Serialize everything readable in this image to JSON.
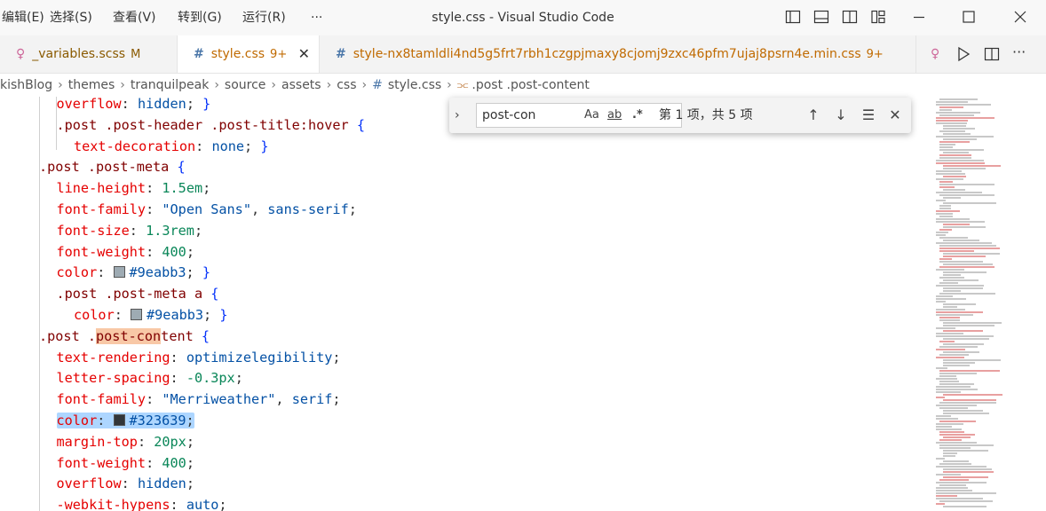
{
  "menu": [
    "编辑(E)",
    "选择(S)",
    "查看(V)",
    "转到(G)",
    "运行(R)",
    "···"
  ],
  "window_title": "style.css - Visual Studio Code",
  "tabs": [
    {
      "label": "_variables.scss",
      "badge": "M",
      "icon": "scss-icon"
    },
    {
      "label": "style.css",
      "badge": "9+",
      "icon": "hash-icon",
      "active": true
    },
    {
      "label": "style-nx8tamldli4nd5g5frt7rbh1czgpjmaxy8cjomj9zxc46pfm7ujaj8psrn4e.min.css",
      "badge": "9+",
      "icon": "hash-icon"
    }
  ],
  "breadcrumb": [
    "kishBlog",
    "themes",
    "tranquilpeak",
    "source",
    "assets",
    "css",
    "style.css",
    ".post .post-content"
  ],
  "find": {
    "query": "post-con",
    "options": [
      "Aa",
      "ab",
      ".*"
    ],
    "count": "第 1 项，共 5 项"
  },
  "code": [
    {
      "indent": 1,
      "parts": [
        [
          "prop",
          "overflow"
        ],
        [
          "punc",
          ": "
        ],
        [
          "val",
          "hidden"
        ],
        [
          "punc",
          "; "
        ],
        [
          "brace",
          "}"
        ]
      ]
    },
    {
      "indent": 1,
      "parts": [
        [
          "sel",
          ".post .post-header .post-title:hover "
        ],
        [
          "brace",
          "{"
        ]
      ]
    },
    {
      "indent": 2,
      "parts": [
        [
          "prop",
          "text-decoration"
        ],
        [
          "punc",
          ": "
        ],
        [
          "val",
          "none"
        ],
        [
          "punc",
          "; "
        ],
        [
          "brace",
          "}"
        ]
      ]
    },
    {
      "indent": 0,
      "parts": [
        [
          "sel",
          ".post .post-meta "
        ],
        [
          "brace",
          "{"
        ]
      ]
    },
    {
      "indent": 1,
      "parts": [
        [
          "prop",
          "line-height"
        ],
        [
          "punc",
          ": "
        ],
        [
          "num",
          "1.5em"
        ],
        [
          "punc",
          ";"
        ]
      ]
    },
    {
      "indent": 1,
      "parts": [
        [
          "prop",
          "font-family"
        ],
        [
          "punc",
          ": "
        ],
        [
          "val",
          "\"Open Sans\""
        ],
        [
          "punc",
          ", "
        ],
        [
          "val",
          "sans-serif"
        ],
        [
          "punc",
          ";"
        ]
      ]
    },
    {
      "indent": 1,
      "parts": [
        [
          "prop",
          "font-size"
        ],
        [
          "punc",
          ": "
        ],
        [
          "num",
          "1.3rem"
        ],
        [
          "punc",
          ";"
        ]
      ]
    },
    {
      "indent": 1,
      "parts": [
        [
          "prop",
          "font-weight"
        ],
        [
          "punc",
          ": "
        ],
        [
          "num",
          "400"
        ],
        [
          "punc",
          ";"
        ]
      ]
    },
    {
      "indent": 1,
      "parts": [
        [
          "prop",
          "color"
        ],
        [
          "punc",
          ": "
        ],
        [
          "swatch",
          "#9eabb3"
        ],
        [
          "val",
          "#9eabb3"
        ],
        [
          "punc",
          "; "
        ],
        [
          "brace",
          "}"
        ]
      ]
    },
    {
      "indent": 1,
      "parts": [
        [
          "sel",
          ".post .post-meta a "
        ],
        [
          "brace",
          "{"
        ]
      ]
    },
    {
      "indent": 2,
      "parts": [
        [
          "prop",
          "color"
        ],
        [
          "punc",
          ": "
        ],
        [
          "swatch",
          "#9eabb3"
        ],
        [
          "val",
          "#9eabb3"
        ],
        [
          "punc",
          "; "
        ],
        [
          "brace",
          "}"
        ]
      ]
    },
    {
      "indent": 0,
      "parts": [
        [
          "sel",
          ".post ."
        ],
        [
          "hl",
          "post-con"
        ],
        [
          "sel",
          "tent "
        ],
        [
          "brace",
          "{"
        ]
      ]
    },
    {
      "indent": 1,
      "parts": [
        [
          "prop",
          "text-rendering"
        ],
        [
          "punc",
          ": "
        ],
        [
          "val",
          "optimizelegibility"
        ],
        [
          "punc",
          ";"
        ]
      ]
    },
    {
      "indent": 1,
      "parts": [
        [
          "prop",
          "letter-spacing"
        ],
        [
          "punc",
          ": "
        ],
        [
          "num",
          "-0.3px"
        ],
        [
          "punc",
          ";"
        ]
      ]
    },
    {
      "indent": 1,
      "parts": [
        [
          "prop",
          "font-family"
        ],
        [
          "punc",
          ": "
        ],
        [
          "val",
          "\"Merriweather\""
        ],
        [
          "punc",
          ", "
        ],
        [
          "val",
          "serif"
        ],
        [
          "punc",
          ";"
        ]
      ]
    },
    {
      "indent": 1,
      "selected": true,
      "parts": [
        [
          "prop",
          "color"
        ],
        [
          "punc",
          ": "
        ],
        [
          "swatch",
          "#323639"
        ],
        [
          "val",
          "#323639"
        ],
        [
          "punc",
          ";"
        ]
      ]
    },
    {
      "indent": 1,
      "parts": [
        [
          "prop",
          "margin-top"
        ],
        [
          "punc",
          ": "
        ],
        [
          "num",
          "20px"
        ],
        [
          "punc",
          ";"
        ]
      ]
    },
    {
      "indent": 1,
      "parts": [
        [
          "prop",
          "font-weight"
        ],
        [
          "punc",
          ": "
        ],
        [
          "num",
          "400"
        ],
        [
          "punc",
          ";"
        ]
      ]
    },
    {
      "indent": 1,
      "parts": [
        [
          "prop",
          "overflow"
        ],
        [
          "punc",
          ": "
        ],
        [
          "val",
          "hidden"
        ],
        [
          "punc",
          ";"
        ]
      ]
    },
    {
      "indent": 1,
      "parts": [
        [
          "prop",
          "-webkit-hypens"
        ],
        [
          "punc",
          ": "
        ],
        [
          "val",
          "auto"
        ],
        [
          "punc",
          ";"
        ]
      ]
    }
  ],
  "colors": {
    "accent": "#0078d4",
    "badge": "#c06a00",
    "selection": "#add6ff",
    "match": "#f8c8a6"
  }
}
